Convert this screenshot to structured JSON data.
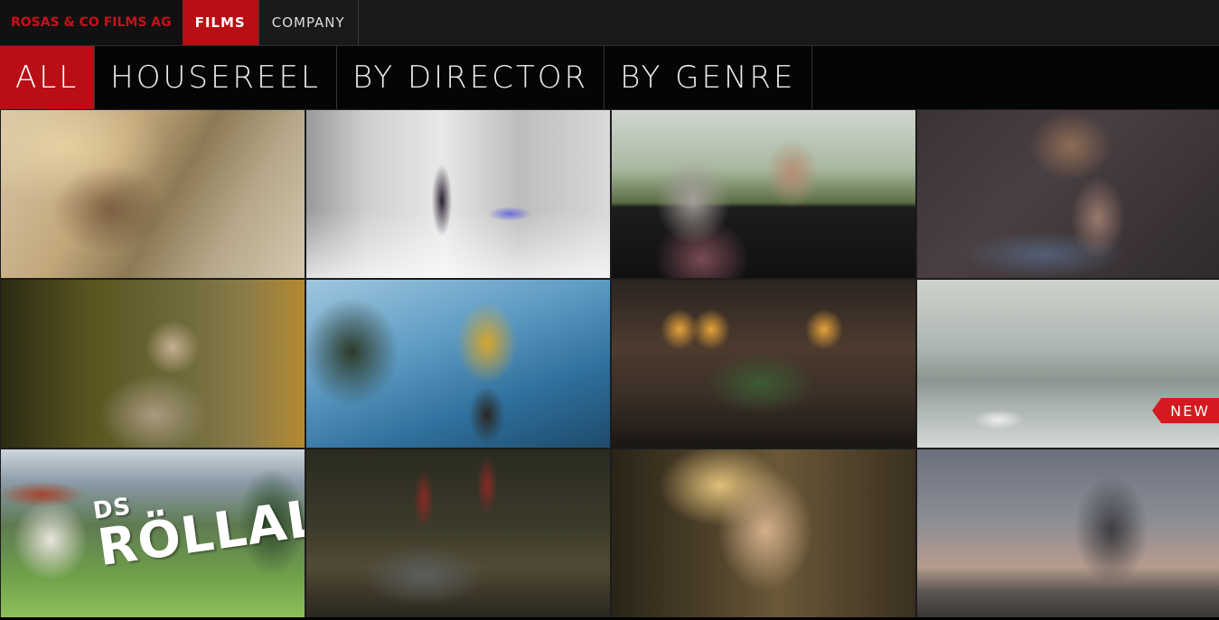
{
  "topnav": {
    "brand": "ROSAS & CO FILMS AG",
    "items": [
      {
        "label": "FILMS",
        "active": true
      },
      {
        "label": "COMPANY",
        "active": false
      }
    ]
  },
  "subnav": {
    "tabs": [
      {
        "label": "ALL",
        "active": true
      },
      {
        "label": "HOUSEREEL",
        "active": false
      },
      {
        "label": "BY DIRECTOR",
        "active": false
      },
      {
        "label": "BY GENRE",
        "active": false
      }
    ]
  },
  "grid": {
    "badge": "NEW",
    "overlay_small": "DS",
    "overlay_big": "RÖLLALI"
  },
  "colors": {
    "accent": "#b80e14",
    "brand_text": "#c8101a",
    "badge": "#d41920"
  }
}
